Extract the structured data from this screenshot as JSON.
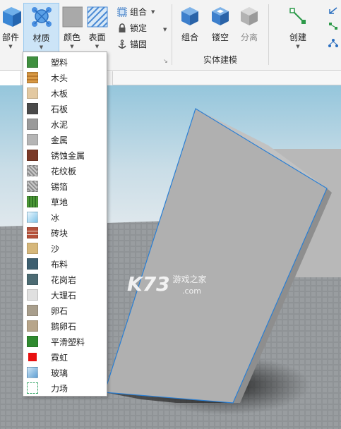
{
  "ribbon": {
    "buttons": {
      "part": {
        "label": "部件"
      },
      "material": {
        "label": "材质"
      },
      "color": {
        "label": "颜色"
      },
      "surface": {
        "label": "表面"
      },
      "union": {
        "label": "组合"
      },
      "negate": {
        "label": "镂空"
      },
      "separate": {
        "label": "分离"
      },
      "create": {
        "label": "创建"
      }
    },
    "small": {
      "group": "组合",
      "lock": "锁定",
      "anchor": "锚固"
    },
    "groups": {
      "solid_modeling": "实体建模"
    }
  },
  "material_menu": {
    "items": [
      {
        "label": "塑料",
        "icon": "plastic-swatch",
        "color": "#3f8f3f"
      },
      {
        "label": "木头",
        "icon": "wood-swatch",
        "color": "#c98a3a"
      },
      {
        "label": "木板",
        "icon": "wood-planks-swatch",
        "color": "#e3c9a2"
      },
      {
        "label": "石板",
        "icon": "slate-swatch",
        "color": "#4a4a4a"
      },
      {
        "label": "水泥",
        "icon": "concrete-swatch",
        "color": "#9a9a9a"
      },
      {
        "label": "金属",
        "icon": "metal-swatch",
        "color": "#b5b5b5"
      },
      {
        "label": "锈蚀金属",
        "icon": "corroded-metal-swatch",
        "color": "#7a3a28"
      },
      {
        "label": "花纹板",
        "icon": "diamond-plate-swatch",
        "color": "#a0a0a0"
      },
      {
        "label": "锡箔",
        "icon": "foil-swatch",
        "color": "#cfcfcf"
      },
      {
        "label": "草地",
        "icon": "grass-swatch",
        "color": "#3e8a2e"
      },
      {
        "label": "冰",
        "icon": "ice-swatch",
        "color": "#7ec3e8"
      },
      {
        "label": "砖块",
        "icon": "brick-swatch",
        "color": "#b5503a"
      },
      {
        "label": "沙",
        "icon": "sand-swatch",
        "color": "#d6b77a"
      },
      {
        "label": "布料",
        "icon": "fabric-swatch",
        "color": "#3d5f70"
      },
      {
        "label": "花岗岩",
        "icon": "granite-swatch",
        "color": "#4c6b73"
      },
      {
        "label": "大理石",
        "icon": "marble-swatch",
        "color": "#e0e0e0"
      },
      {
        "label": "卵石",
        "icon": "pebble-swatch",
        "color": "#a89e8c"
      },
      {
        "label": "鹅卵石",
        "icon": "cobblestone-swatch",
        "color": "#b7a58a"
      },
      {
        "label": "平滑塑料",
        "icon": "smooth-plastic-swatch",
        "color": "#2f8a2f"
      },
      {
        "label": "霓虹",
        "icon": "neon-swatch",
        "color": "#e81010"
      },
      {
        "label": "玻璃",
        "icon": "glass-swatch",
        "color": "#8bbbe0"
      },
      {
        "label": "力场",
        "icon": "forcefield-swatch",
        "color": "#3aa66a"
      }
    ]
  },
  "watermark": {
    "brand": "K73",
    "site_text": "游戏之家",
    "domain": ".com"
  },
  "colors": {
    "accent": "#2a7fd4",
    "menu_hover": "#cce4f7",
    "part_color": "#a3a3a3"
  }
}
